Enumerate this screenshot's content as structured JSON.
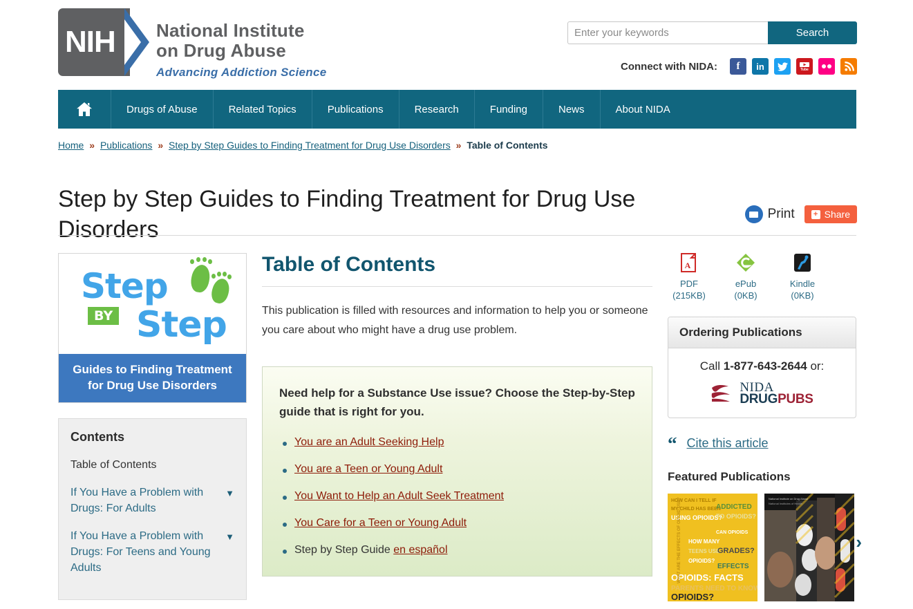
{
  "header": {
    "logo": {
      "mark_text": "NIH",
      "line1": "National Institute",
      "line2": "on Drug Abuse",
      "tagline": "Advancing Addiction Science"
    },
    "search": {
      "placeholder": "Enter your keywords",
      "value": "",
      "button_label": "Search"
    },
    "connect": {
      "label": "Connect with NIDA:",
      "icons": [
        {
          "name": "facebook-icon",
          "glyph": "f",
          "color": "#3b5998"
        },
        {
          "name": "linkedin-icon",
          "glyph": "in",
          "color": "#0e76a8"
        },
        {
          "name": "twitter-icon",
          "glyph": "ᴠ",
          "color": "#1da1f2"
        },
        {
          "name": "youtube-icon",
          "glyph": "You Tube",
          "color": "#cc181e"
        },
        {
          "name": "flickr-icon",
          "glyph": "••",
          "color": "#ff0084"
        },
        {
          "name": "rss-icon",
          "glyph": "◔",
          "color": "#f57c00"
        }
      ]
    }
  },
  "nav": {
    "home_label": "Home",
    "items": [
      {
        "label": "Drugs of Abuse"
      },
      {
        "label": "Related Topics"
      },
      {
        "label": "Publications"
      },
      {
        "label": "Research"
      },
      {
        "label": "Funding"
      },
      {
        "label": "News"
      },
      {
        "label": "About NIDA"
      }
    ]
  },
  "breadcrumb": {
    "separator": "»",
    "items": [
      {
        "label": "Home",
        "current": false
      },
      {
        "label": "Publications",
        "current": false
      },
      {
        "label": "Step by Step Guides to Finding Treatment for Drug Use Disorders",
        "current": false
      },
      {
        "label": "Table of Contents",
        "current": true
      }
    ]
  },
  "page": {
    "title": "Step by Step Guides to Finding Treatment for Drug Use Disorders",
    "print_label": "Print",
    "share_label": "Share",
    "share_plus": "+"
  },
  "cover": {
    "word_step1": "Step",
    "word_by": "BY",
    "word_step2": "Step",
    "band_line1": "Guides to Finding Treatment",
    "band_line2": "for Drug Use Disorders"
  },
  "contents": {
    "title": "Contents",
    "items": [
      {
        "label": "Table of Contents",
        "expandable": false,
        "current": true
      },
      {
        "label": "If You Have a Problem with Drugs: For Adults",
        "expandable": true,
        "current": false
      },
      {
        "label": "If You Have a Problem with Drugs: For Teens and Young Adults",
        "expandable": true,
        "current": false
      }
    ],
    "caret_glyph": "▼"
  },
  "main": {
    "heading": "Table of Contents",
    "intro": "This publication is filled with resources and information to help you or someone you care about who might have a drug use problem.",
    "callout": {
      "heading": "Need help for a Substance Use issue? Choose the Step-by-Step guide that is right for you.",
      "items": [
        {
          "text": "You are an Adult Seeking Help",
          "link": true
        },
        {
          "text": "You are a Teen or Young Adult",
          "link": true
        },
        {
          "text": "You Want to Help an Adult Seek Treatment",
          "link": true
        },
        {
          "text": "You Care for a Teen or Young Adult",
          "link": true
        },
        {
          "text": "Step by Step Guide ",
          "link": false,
          "link_tail": "en español"
        }
      ]
    }
  },
  "sidebar_right": {
    "downloads": [
      {
        "name": "PDF",
        "size": "(215KB)",
        "icon": "pdf-icon"
      },
      {
        "name": "ePub",
        "size": "(0KB)",
        "icon": "epub-icon"
      },
      {
        "name": "Kindle",
        "size": "(0KB)",
        "icon": "kindle-icon"
      }
    ],
    "ordering": {
      "title": "Ordering Publications",
      "call_prefix": "Call ",
      "phone": "1-877-643-2644",
      "call_suffix": " or:",
      "logo_nida": "NIDA",
      "logo_drug": "DRUG",
      "logo_pubs": "PUBS"
    },
    "cite": {
      "quote_glyph": "“",
      "label": "Cite this article"
    },
    "featured": {
      "title": "Featured Publications",
      "next_glyph": "›",
      "items": [
        {
          "name": "opioids-facts-parents-need-to-know",
          "lines": [
            "HOW CAN I TELL IF",
            "MY CHILD HAS BEEN",
            "USING OPIOIDS?",
            "ADDICTED",
            "TO OPIOIDS?",
            "CAN OPIOIDS",
            "HOW MANY",
            "TEENS USE",
            "GRADES?",
            "OPIOIDS?",
            "EFFECTS",
            "OPIOIDS: FACTS",
            "PARENTS NEED TO KNOW",
            "OPIOIDS?"
          ]
        },
        {
          "name": "teen-prescription-drug-publication",
          "lines": []
        }
      ]
    }
  },
  "colors": {
    "nav_teal": "#11667f",
    "heading_teal": "#11556e",
    "link_maroon": "#8d1b08",
    "share_orange": "#f4603e",
    "logo_grey": "#5f6062",
    "logo_blue": "#3a6ea8",
    "cover_blue": "#42a5e8",
    "cover_green": "#6cbe45",
    "band_blue": "#3d78bf"
  }
}
